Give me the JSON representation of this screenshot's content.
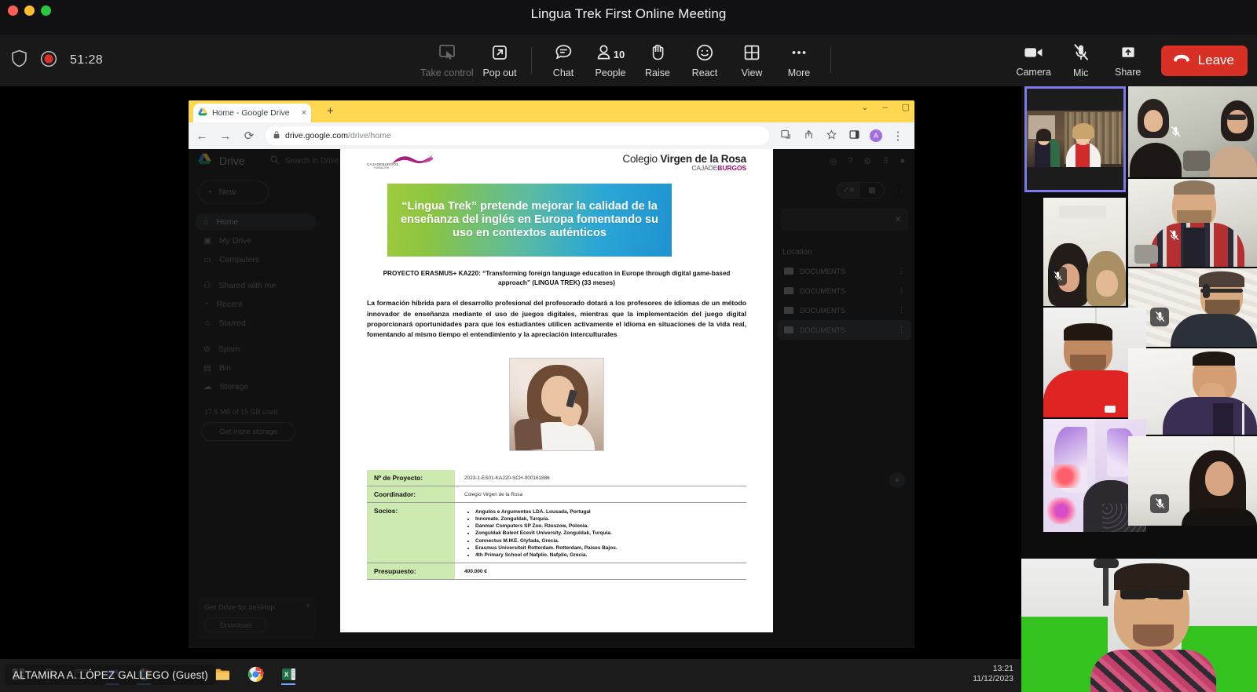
{
  "window": {
    "meeting_title": "Lingua Trek First Online Meeting",
    "traffic_lights": [
      "close",
      "minimize",
      "zoom"
    ]
  },
  "toolbar": {
    "shield_icon": "shield-icon",
    "record_icon": "record-icon",
    "recording_time": "51:28",
    "buttons": [
      {
        "label": "Take control",
        "icon": "take-control-icon",
        "disabled": true
      },
      {
        "label": "Pop out",
        "icon": "pop-out-icon",
        "disabled": false
      },
      {
        "label": "Chat",
        "icon": "chat-icon",
        "disabled": false
      },
      {
        "label": "People",
        "icon": "people-icon",
        "disabled": false,
        "count": "10"
      },
      {
        "label": "Raise",
        "icon": "raise-hand-icon",
        "disabled": false
      },
      {
        "label": "React",
        "icon": "react-smiley-icon",
        "disabled": false
      },
      {
        "label": "View",
        "icon": "view-grid-icon",
        "disabled": false
      },
      {
        "label": "More",
        "icon": "more-ellipsis-icon",
        "disabled": false
      }
    ],
    "right_buttons": [
      {
        "label": "Camera",
        "icon": "camera-icon"
      },
      {
        "label": "Mic",
        "icon": "mic-muted-icon"
      },
      {
        "label": "Share",
        "icon": "share-up-arrow-icon"
      }
    ],
    "leave": {
      "label": "Leave",
      "icon": "hang-up-icon",
      "color": "#d93025"
    }
  },
  "browser": {
    "tab": {
      "title": "Home - Google Drive",
      "favicon": "google-drive-icon",
      "close": "×"
    },
    "new_tab": "+",
    "window_controls": {
      "minimize": "⌄",
      "restore": "–",
      "maximize": "▢"
    },
    "nav": {
      "back": "←",
      "forward": "→",
      "reload": "⟳"
    },
    "omnibox": {
      "lock_icon": "lock-icon",
      "url_host": "drive.google.com",
      "url_path": "/drive/home"
    },
    "omni_actions": [
      "install-icon",
      "share-icon",
      "bookmark-star-icon",
      "side-panel-icon"
    ],
    "profile_initial": "A"
  },
  "drive": {
    "logo_label": "Drive",
    "search_placeholder": "Search in Drive",
    "new_button": "New",
    "sidebar": [
      {
        "label": "Home",
        "icon": "home-icon",
        "active": true
      },
      {
        "label": "My Drive",
        "icon": "my-drive-icon",
        "active": false
      },
      {
        "label": "Computers",
        "icon": "computers-icon",
        "active": false
      },
      {
        "label": "Shared with me",
        "icon": "shared-with-me-icon",
        "active": false
      },
      {
        "label": "Recent",
        "icon": "recent-clock-icon",
        "active": false
      },
      {
        "label": "Starred",
        "icon": "star-icon",
        "active": false
      },
      {
        "label": "Spam",
        "icon": "spam-icon",
        "active": false
      },
      {
        "label": "Bin",
        "icon": "bin-icon",
        "active": false
      },
      {
        "label": "Storage",
        "icon": "cloud-storage-icon",
        "active": false
      }
    ],
    "storage_text": "17.5 MB of 15 GB used",
    "storage_button": "Get more storage",
    "promo": {
      "title": "Get Drive for desktop",
      "button": "Download",
      "close": "×"
    },
    "detail_panel": {
      "location_label": "Location",
      "rows": [
        {
          "label": "DOCUMENTS",
          "selected": false
        },
        {
          "label": "DOCUMENTS",
          "selected": false
        },
        {
          "label": "DOCUMENTS",
          "selected": false
        },
        {
          "label": "DOCUMENTS",
          "selected": true
        }
      ]
    }
  },
  "document": {
    "logo_left": {
      "name": "CAJADEBURGOS",
      "sub": "FUNDACIÓN"
    },
    "logo_right": {
      "line1_thin": "Colegio ",
      "line1_bold": "Virgen de la Rosa",
      "line2_a": "CAJADE",
      "line2_b": "BURGOS"
    },
    "banner_text": "“Lingua Trek” pretende mejorar la calidad de la enseñanza del inglés en Europa fomentando su uso en contextos auténticos",
    "project_title": "PROYECTO ERASMUS+ KA220: “Transforming foreign language education in Europe through digital game-based approach” (LINGUA TREK) (33 meses)",
    "paragraph": "La formación híbrida para el desarrollo profesional del profesorado dotará a los profesores de idiomas de un método innovador de enseñanza mediante el uso de juegos digitales, mientras que la implementación del juego digital proporcionará oportunidades para que los estudiantes utilicen activamente el idioma en situaciones de la vida real, fomentando al mismo tiempo el entendimiento y la apreciación interculturales",
    "table": {
      "project_number_label": "Nº de Proyecto:",
      "project_number_value": "2023-1-ES01-KA220-SCH-000161886",
      "coordinator_label": "Coordinador:",
      "coordinator_value": "Colegio Virgen de la Rosa",
      "partners_label": "Socios:",
      "partners": [
        "Angulos e Argumentos LDA. Lousada, Portugal",
        "Innomate. Zonguldak, Turquía.",
        "Danmar Computers SP Zoo. Rzeszow, Polonia.",
        "Zonguldak Bulent Ecevit University. Zonguldak, Turquía.",
        "Connectus M.IKE. Glyfada, Grecia.",
        "Erasmus Universiteit Rotterdam. Rotterdam, Países Bajos.",
        "4th Primary School of Nafplio. Nafplio, Grecia."
      ],
      "budget_label": "Presupuesto:",
      "budget_value": "400.000 €"
    }
  },
  "participants": [
    {
      "id": "tile-1",
      "active_speaker": true,
      "muted": false,
      "scene": "two-women-library"
    },
    {
      "id": "tile-2",
      "active_speaker": false,
      "muted": true,
      "scene": "two-women-office"
    },
    {
      "id": "tile-3",
      "active_speaker": false,
      "muted": true,
      "scene": "man-plaid-shirt"
    },
    {
      "id": "tile-4",
      "active_speaker": false,
      "muted": true,
      "scene": "two-women-white-room"
    },
    {
      "id": "tile-5",
      "active_speaker": false,
      "muted": true,
      "scene": "man-glasses-headphones"
    },
    {
      "id": "tile-6",
      "active_speaker": false,
      "muted": false,
      "scene": "man-red-hoodie"
    },
    {
      "id": "tile-7",
      "active_speaker": false,
      "muted": false,
      "scene": "man-hand-on-chin"
    },
    {
      "id": "tile-8",
      "active_speaker": false,
      "muted": false,
      "scene": "purple-ceiling-room"
    },
    {
      "id": "tile-9",
      "active_speaker": false,
      "muted": true,
      "scene": "woman-dark-hair"
    },
    {
      "id": "tile-10",
      "active_speaker": false,
      "muted": false,
      "scene": "man-green-screen"
    }
  ],
  "taskbar": {
    "presenter_name": "ALTAMIRA A. LÓPEZ GALLEGO (Guest)",
    "apps": [
      {
        "name": "file-explorer-icon"
      },
      {
        "name": "google-chrome-icon"
      },
      {
        "name": "excel-icon"
      }
    ],
    "clock_time": "13:21",
    "clock_date": "11/12/2023"
  }
}
